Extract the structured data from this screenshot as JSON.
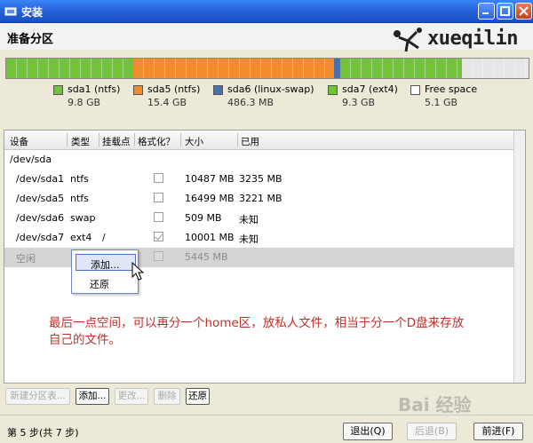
{
  "window": {
    "title": "安装"
  },
  "header": {
    "page_title": "准备分区",
    "logo_text": "xueqilin"
  },
  "disk_bar": {
    "segments": [
      {
        "name": "sda1",
        "color": "#73c23b"
      },
      {
        "name": "sda5",
        "color": "#f08c2e"
      },
      {
        "name": "sda6",
        "color": "#4a6fad"
      },
      {
        "name": "sda7",
        "color": "#73c23b"
      },
      {
        "name": "free",
        "color": "#e6e6e6"
      }
    ]
  },
  "legend": [
    {
      "name": "sda1 (ntfs)",
      "size": "9.8 GB",
      "color": "#73c23b"
    },
    {
      "name": "sda5 (ntfs)",
      "size": "15.4 GB",
      "color": "#f08c2e"
    },
    {
      "name": "sda6 (linux-swap)",
      "size": "486.3 MB",
      "color": "#4a6fad"
    },
    {
      "name": "sda7 (ext4)",
      "size": "9.3 GB",
      "color": "#73c23b"
    },
    {
      "name": "Free space",
      "size": "5.1 GB",
      "color": "#ffffff"
    }
  ],
  "table": {
    "columns": [
      "设备",
      "类型",
      "挂载点",
      "格式化？",
      "大小",
      "已用"
    ],
    "disk": "/dev/sda",
    "rows": [
      {
        "device": "/dev/sda1",
        "type": "ntfs",
        "mount": "",
        "format": false,
        "size": "10487 MB",
        "used": "3235 MB"
      },
      {
        "device": "/dev/sda5",
        "type": "ntfs",
        "mount": "",
        "format": false,
        "size": "16499 MB",
        "used": "3221 MB"
      },
      {
        "device": "/dev/sda6",
        "type": "swap",
        "mount": "",
        "format": false,
        "size": "509 MB",
        "used": "未知"
      },
      {
        "device": "/dev/sda7",
        "type": "ext4",
        "mount": "/",
        "format": true,
        "size": "10001 MB",
        "used": "未知"
      },
      {
        "device": "空闲",
        "type": "",
        "mount": "",
        "format": false,
        "size": "5445 MB",
        "used": ""
      }
    ]
  },
  "context_menu": {
    "items": [
      "添加...",
      "还原"
    ]
  },
  "annotation": "最后一点空间，可以再分一个home区，放私人文件，相当于分一个D盘来存放自己的文件。",
  "toolbar": {
    "new_table": "新建分区表...",
    "add": "添加...",
    "change": "更改...",
    "delete": "删除",
    "revert": "还原"
  },
  "footer": {
    "step": "第 5 步(共 7 步)",
    "quit": "退出(Q)",
    "back": "后退(B)",
    "forward": "前进(F)"
  },
  "watermark": "Bai 经验"
}
